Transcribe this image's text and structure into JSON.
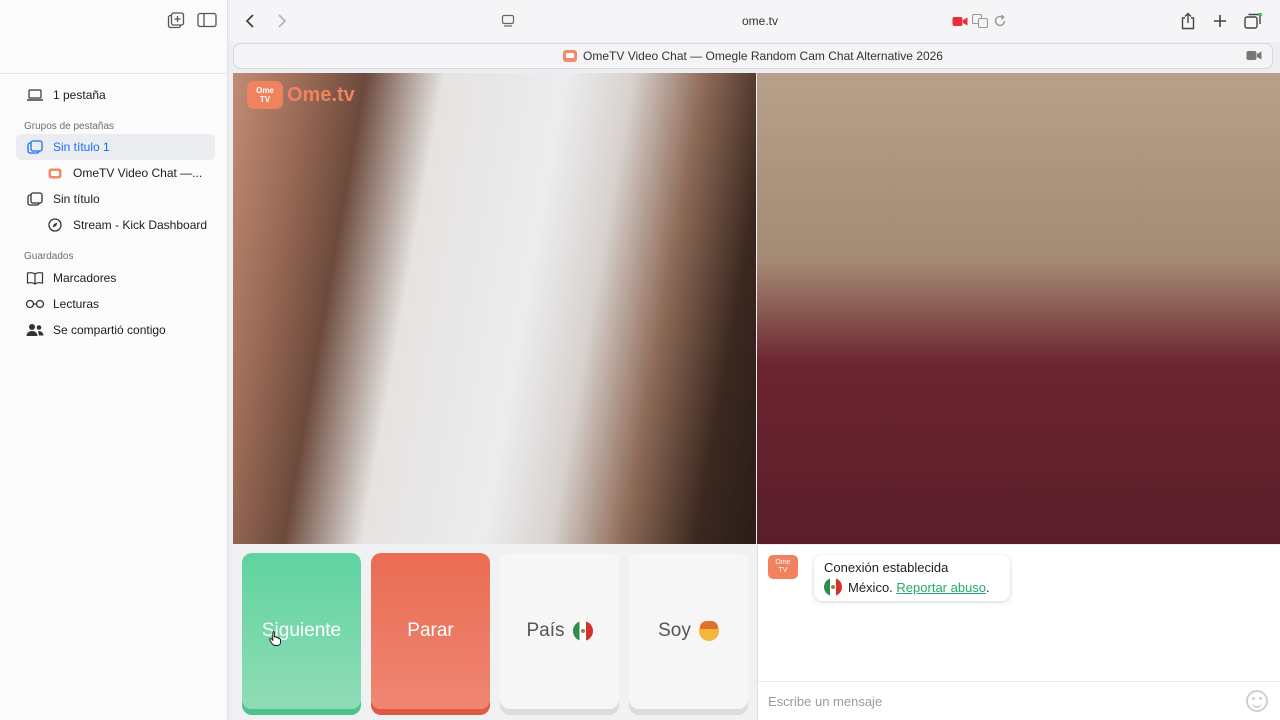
{
  "browser": {
    "url": "ome.tv",
    "tab_title": "OmeTV Video Chat — Omegle Random Cam Chat Alternative 2026"
  },
  "sidebar": {
    "tab_count": "1 pestaña",
    "groups_header": "Grupos de pestañas",
    "groups": [
      {
        "label": "Sin título 1",
        "active": true
      },
      {
        "label": "OmeTV Video Chat —...",
        "indent": true
      },
      {
        "label": "Sin título"
      },
      {
        "label": "Stream - Kick Dashboard",
        "indent": true
      }
    ],
    "saved_header": "Guardados",
    "saved": [
      {
        "label": "Marcadores"
      },
      {
        "label": "Lecturas"
      },
      {
        "label": "Se compartió contigo"
      }
    ]
  },
  "video": {
    "logo_badge_line1": "Ome",
    "logo_badge_line2": "TV",
    "logo_text": "Ome.tv"
  },
  "controls": {
    "next_label": "Siguiente",
    "stop_label": "Parar",
    "country_label": "País",
    "me_label": "Soy"
  },
  "chat": {
    "connection_text": "Conexión establecida",
    "country": "México.",
    "report_link": "Reportar abuso",
    "report_suffix": ".",
    "message_placeholder": "Escribe un mensaje"
  },
  "colors": {
    "next": "#5fd3a0",
    "stop": "#ea6c53",
    "brand": "#f08260",
    "link": "#26a96c",
    "sidebar_active": "#1c6ef2"
  }
}
